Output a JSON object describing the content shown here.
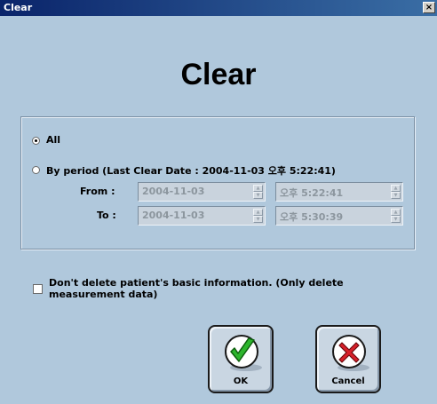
{
  "window": {
    "title": "Clear",
    "close_glyph": "×"
  },
  "heading": "Clear",
  "options": {
    "all_label": "All",
    "all_selected": true,
    "period_label": "By period (Last Clear Date : 2004-11-03 오후 5:22:41)",
    "period_selected": false
  },
  "period": {
    "from_label": "From :",
    "to_label": "To :",
    "from_date": "2004-11-03",
    "from_time": "오후  5:22:41",
    "to_date": "2004-11-03",
    "to_time": "오후  5:30:39"
  },
  "keep_info": {
    "label": "Don't delete patient's basic information. (Only delete measurement data)",
    "checked": false
  },
  "buttons": {
    "ok_label": "OK",
    "cancel_label": "Cancel"
  },
  "icons": {
    "ok": "checkmark-icon",
    "cancel": "x-mark-icon",
    "spin_up": "▲",
    "spin_down": "▼"
  },
  "colors": {
    "dialog_bg": "#b0c8dc",
    "ok_green": "#2db52d",
    "cancel_red": "#d8202a"
  }
}
